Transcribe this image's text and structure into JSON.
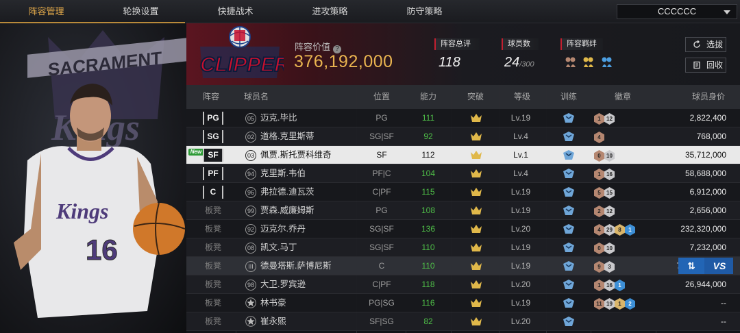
{
  "nav": {
    "tabs": [
      "阵容管理",
      "轮换设置",
      "快捷战术",
      "进攻策略",
      "防守策略"
    ],
    "active_tab": "阵容管理",
    "team_select": "CCCCCC"
  },
  "portrait": {
    "backdrop_text": "SACRAMENTO Kings",
    "jersey_team": "Kings",
    "jersey_number": "16"
  },
  "header": {
    "logo_text": "CLIPPERS",
    "lineup_value_label": "阵容价值",
    "lineup_value": "376,192,000",
    "overall_label": "阵容总评",
    "overall_value": "118",
    "players_label": "球员数",
    "players_value": "24",
    "players_max": "/300",
    "bond_label": "阵容羁绊",
    "select_button": "选拔",
    "recycle_button": "回收"
  },
  "table": {
    "columns": [
      "阵容",
      "球员名",
      "位置",
      "能力",
      "突破",
      "等级",
      "训练",
      "徽章",
      "球员身价"
    ],
    "rows": [
      {
        "slot": "PG",
        "num": "05",
        "name": "迈克.毕比",
        "pos": "PG",
        "ability": "111",
        "level": "Lv.19",
        "badges": [
          [
            "bronze",
            "1"
          ],
          [
            "silver",
            "12"
          ]
        ],
        "worth": "2,822,400"
      },
      {
        "slot": "SG",
        "num": "02",
        "name": "道格.克里斯蒂",
        "pos": "SG|SF",
        "ability": "92",
        "level": "Lv.4",
        "badges": [
          [
            "bronze",
            "4"
          ]
        ],
        "worth": "768,000"
      },
      {
        "slot": "SF",
        "new": "New",
        "num": "03",
        "name": "佩贾.斯托贾科维奇",
        "pos": "SF",
        "ability": "112",
        "level": "Lv.1",
        "badges": [
          [
            "bronze",
            "0"
          ],
          [
            "silver",
            "10"
          ]
        ],
        "worth": "35,712,000"
      },
      {
        "slot": "PF",
        "num": "94",
        "name": "克里斯.韦伯",
        "pos": "PF|C",
        "ability": "104",
        "level": "Lv.4",
        "badges": [
          [
            "bronze",
            "1"
          ],
          [
            "silver",
            "16"
          ]
        ],
        "worth": "58,688,000"
      },
      {
        "slot": "C",
        "num": "96",
        "name": "弗拉德.迪瓦茨",
        "pos": "C|PF",
        "ability": "115",
        "level": "Lv.19",
        "badges": [
          [
            "bronze",
            "5"
          ],
          [
            "silver",
            "15"
          ]
        ],
        "worth": "6,912,000"
      },
      {
        "slot": "板凳",
        "num": "99",
        "name": "贾森.威廉姆斯",
        "pos": "PG",
        "ability": "108",
        "level": "Lv.19",
        "badges": [
          [
            "bronze",
            "2"
          ],
          [
            "silver",
            "12"
          ]
        ],
        "worth": "2,656,000"
      },
      {
        "slot": "板凳",
        "num": "92",
        "name": "迈克尔.乔丹",
        "pos": "SG|SF",
        "ability": "136",
        "level": "Lv.20",
        "badges": [
          [
            "bronze",
            "4"
          ],
          [
            "silver",
            "29"
          ],
          [
            "gold",
            "8"
          ],
          [
            "blue",
            "1"
          ]
        ],
        "worth": "232,320,000"
      },
      {
        "slot": "板凳",
        "num": "08",
        "name": "凯文.马丁",
        "pos": "SG|SF",
        "ability": "110",
        "level": "Lv.19",
        "badges": [
          [
            "bronze",
            "0"
          ],
          [
            "silver",
            "10"
          ]
        ],
        "worth": "7,232,000"
      },
      {
        "slot": "板凳",
        "num": "III",
        "name": "德曼塔斯.萨博尼斯",
        "pos": "C",
        "ability": "110",
        "level": "Lv.19",
        "badges": [
          [
            "bronze",
            "9"
          ],
          [
            "silver",
            "3"
          ]
        ],
        "worth": "7",
        "swap": "VS"
      },
      {
        "slot": "板凳",
        "num": "98",
        "name": "大卫.罗宾逊",
        "pos": "C|PF",
        "ability": "118",
        "level": "Lv.20",
        "badges": [
          [
            "bronze",
            "1"
          ],
          [
            "silver",
            "16"
          ],
          [
            "blue",
            "1"
          ]
        ],
        "worth": "26,944,000"
      },
      {
        "slot": "板凳",
        "num": "★",
        "name": "林书豪",
        "pos": "PG|SG",
        "ability": "116",
        "level": "Lv.19",
        "badges": [
          [
            "bronze",
            "11"
          ],
          [
            "silver",
            "19"
          ],
          [
            "gold",
            "1"
          ],
          [
            "blue",
            "2"
          ]
        ],
        "worth": "--"
      },
      {
        "slot": "板凳",
        "num": "★",
        "name": "崔永熙",
        "pos": "SF|SG",
        "ability": "82",
        "level": "Lv.20",
        "badges": [],
        "worth": "--"
      }
    ]
  },
  "colors": {
    "accent_gold": "#e9b450",
    "ability_green": "#4fbf48",
    "selected_row": "#e9e9e9",
    "header_red": "#5b1520"
  }
}
